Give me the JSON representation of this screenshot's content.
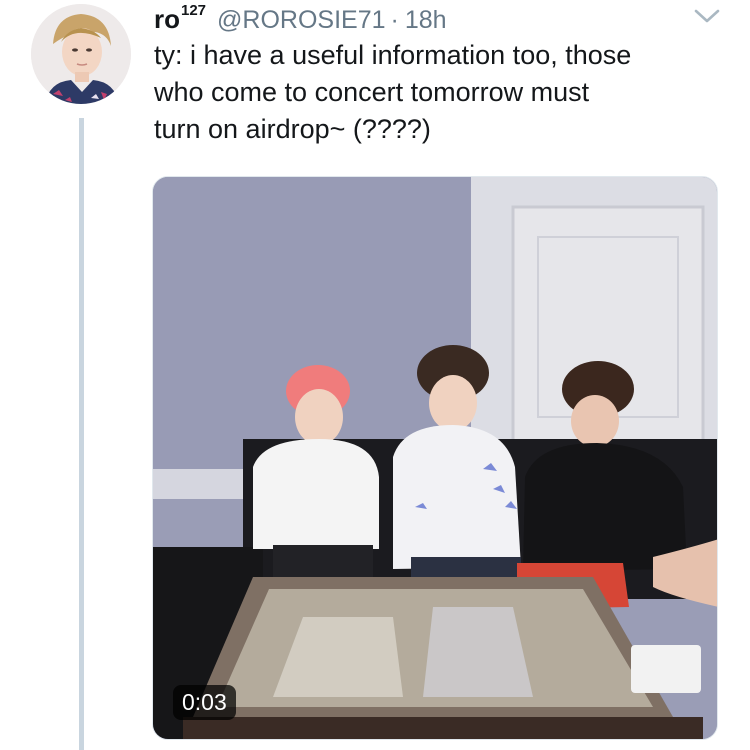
{
  "tweet": {
    "display_name": "ro",
    "display_name_sup": "127",
    "handle": "@ROROSIE71",
    "separator": "·",
    "time": "18h",
    "text": "ty: i have a useful information too, those\nwho come to concert tomorrow must\nturn on airdrop~ (????)"
  },
  "media": {
    "type": "video",
    "duration": "0:03"
  },
  "icons": {
    "menu": "chevron-down-icon",
    "avatar": "profile-avatar"
  },
  "colors": {
    "text": "#14171a",
    "secondary": "#657786",
    "thread_line": "#c9d5df"
  }
}
